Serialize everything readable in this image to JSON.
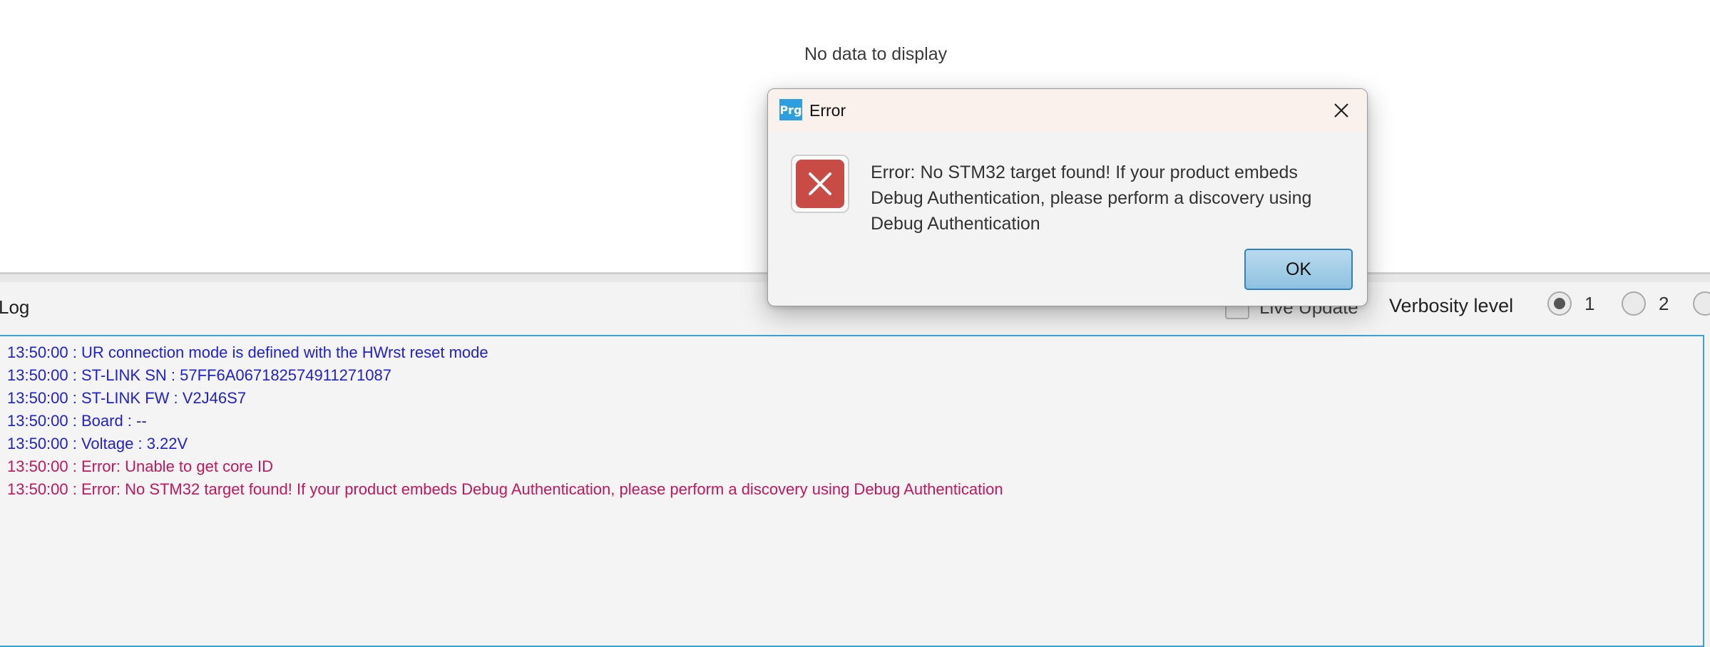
{
  "main": {
    "placeholder_text": "No data to display"
  },
  "log_panel": {
    "title": "Log",
    "live_update_label": "Live Update",
    "verbosity_label": "Verbosity level",
    "verbosity_options": [
      "1",
      "2"
    ],
    "verbosity_selected": "1",
    "lines": [
      {
        "text": "13:50:00 : UR connection mode is defined with the HWrst reset mode",
        "level": "info"
      },
      {
        "text": "13:50:00 : ST-LINK SN  : 57FF6A067182574911271087",
        "level": "info"
      },
      {
        "text": "13:50:00 : ST-LINK FW  : V2J46S7",
        "level": "info"
      },
      {
        "text": "13:50:00 : Board       : --",
        "level": "info"
      },
      {
        "text": "13:50:00 : Voltage     : 3.22V",
        "level": "info"
      },
      {
        "text": "13:50:00 : Error: Unable to get core ID",
        "level": "error"
      },
      {
        "text": "13:50:00 : Error: No STM32 target found! If your product embeds Debug Authentication, please perform a discovery using Debug Authentication",
        "level": "error"
      }
    ]
  },
  "dialog": {
    "app_icon_text": "Prg",
    "title": "Error",
    "message": "Error: No STM32 target found! If your product embeds Debug Authentication, please perform a discovery using Debug Authentication",
    "ok_label": "OK"
  },
  "colors": {
    "info_text": "#1f1fd6",
    "error_text": "#c2185b",
    "accent": "#2d84c4",
    "error_icon": "#c94b45"
  }
}
